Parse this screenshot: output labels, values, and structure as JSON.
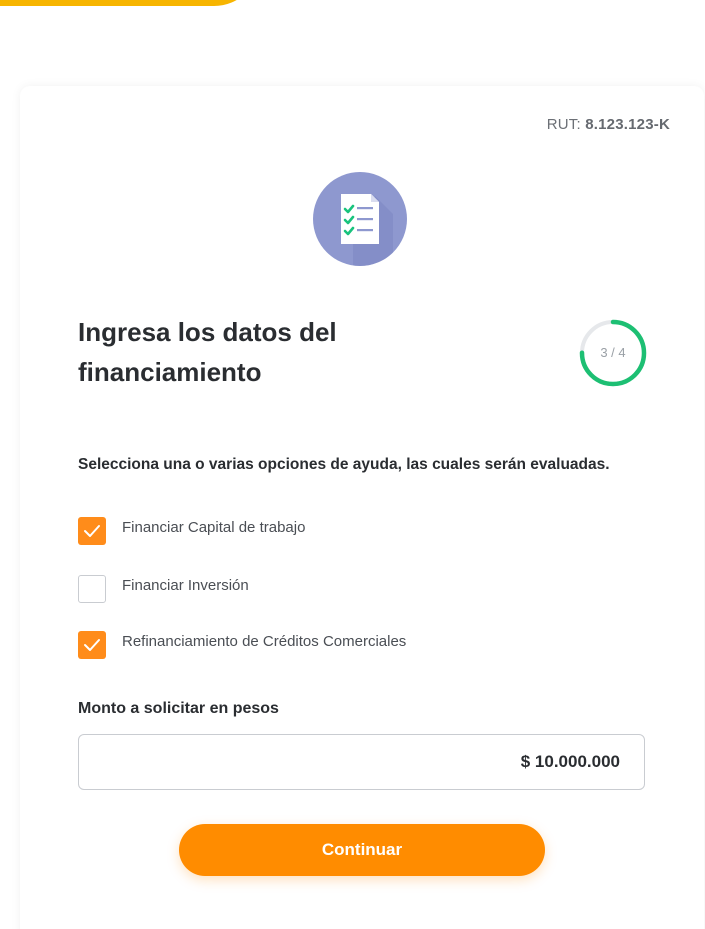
{
  "header": {
    "rut_label": "RUT:",
    "rut_value": "8.123.123-K"
  },
  "hero_icon": "checklist-document-icon",
  "form": {
    "title_line1": "Ingresa los datos del",
    "title_line2": "financiamiento",
    "step": {
      "text": "3 / 4",
      "current": 3,
      "total": 4
    },
    "instructions": "Selecciona una o varias opciones de ayuda, las cuales serán evaluadas.",
    "options": [
      {
        "label": "Financiar Capital de trabajo",
        "checked": true
      },
      {
        "label": "Financiar Inversión",
        "checked": false
      },
      {
        "label": "Refinanciamiento de Créditos Comerciales",
        "checked": true
      }
    ],
    "amount_label": "Monto a solicitar en pesos",
    "amount_value": "$ 10.000.000",
    "continue_label": "Continuar"
  },
  "colors": {
    "accent": "#ff8c00",
    "progress": "#1dbf73",
    "icon_bg": "#8e98cf",
    "brand_yellow": "#f7b500"
  }
}
